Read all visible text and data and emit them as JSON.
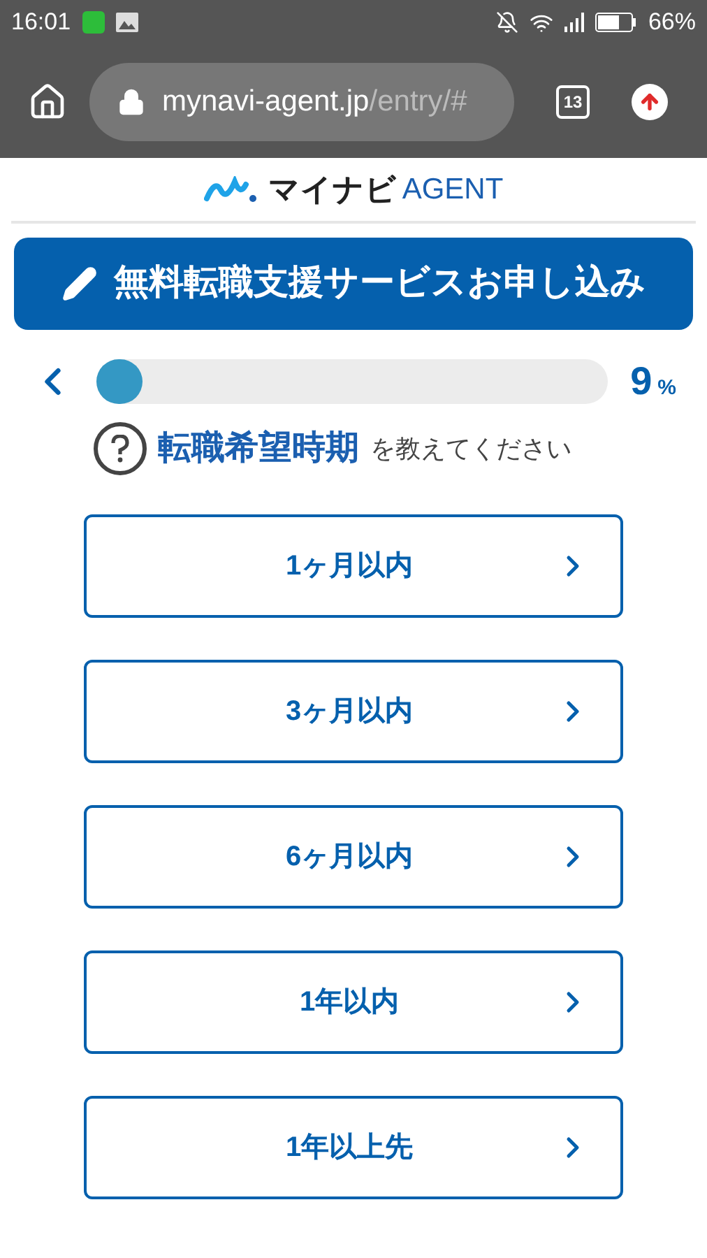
{
  "status_bar": {
    "time": "16:01",
    "battery": "66%"
  },
  "browser": {
    "url_host": "mynavi-agent.jp",
    "url_path": "/entry/#",
    "tab_count": "13"
  },
  "header": {
    "logo_kana": "マイナビ",
    "logo_latin": "AGENT"
  },
  "banner": {
    "label": "無料転職支援サービスお申し込み"
  },
  "progress": {
    "level": 0.09,
    "value": "9",
    "unit": "%"
  },
  "question": {
    "topic": "転職希望時期",
    "text": "を教えてください"
  },
  "options": [
    {
      "label": "1ヶ月以内"
    },
    {
      "label": "3ヶ月以内"
    },
    {
      "label": "6ヶ月以内"
    },
    {
      "label": "1年以内"
    },
    {
      "label": "1年以上先"
    }
  ]
}
